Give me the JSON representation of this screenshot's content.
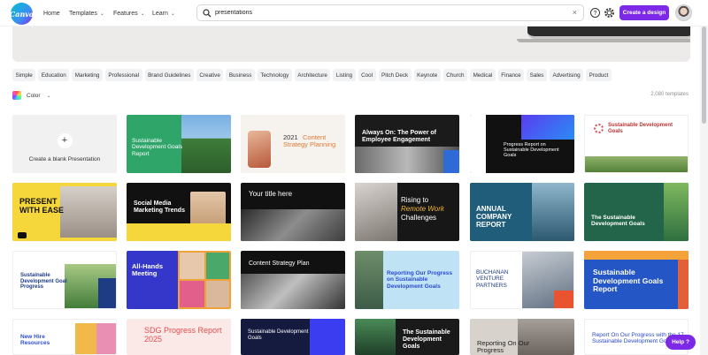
{
  "nav": {
    "home": "Home",
    "templates": "Templates",
    "features": "Features",
    "learn": "Learn"
  },
  "logo_text": "Canva",
  "search": {
    "value": "presentations",
    "placeholder": "Search"
  },
  "create_button": "Create a design",
  "chips": [
    "Simple",
    "Education",
    "Marketing",
    "Professional",
    "Brand Guidelines",
    "Creative",
    "Business",
    "Technology",
    "Architecture",
    "Listing",
    "Cool",
    "Pitch Deck",
    "Keynote",
    "Church",
    "Medical",
    "Finance",
    "Sales",
    "Advertising",
    "Product"
  ],
  "color_filter": "Color",
  "template_count": "2,080 templates",
  "blank_label": "Create a blank Presentation",
  "tiles": {
    "r1c2": "Sustainable Development Goals Report",
    "r1c3_year": "2021",
    "r1c3_title": "Content Strategy Planning",
    "r1c4": "Always On: The Power of Employee Engagement",
    "r1c5": "Progress Report on Sustainable Development Goals",
    "r1c6": "Sustainable Development Goals",
    "r2c1": "PRESENT WITH EASE",
    "r2c2": "Social Media Marketing Trends",
    "r2c3": "Your title here",
    "r2c4_a": "Rising to",
    "r2c4_b": "Remote Work",
    "r2c4_c": "Challenges",
    "r2c5": "ANNUAL COMPANY REPORT",
    "r2c6": "The Sustainable Development Goals",
    "r3c1": "Sustainable Development Goal Progress",
    "r3c2": "All-Hands Meeting",
    "r3c3": "Content Strategy Plan",
    "r3c4": "Reporting Our Progress on Sustainable Development Goals",
    "r3c5": "BUCHANAN VENTURE PARTNERS",
    "r3c6": "Sustainable Development Goals Report",
    "r4c1": "New Hire Resources",
    "r4c2": "SDG Progress Report 2025",
    "r4c3": "Sustainable Development Goals",
    "r4c4": "The Sustainable Development Goals",
    "r4c5": "Reporting On Our Progress",
    "r4c6": "Report On Our Progress with the 17 Sustainable Development Goals"
  },
  "help_button": "Help ?",
  "colors": {
    "accent": "#7d2ae8"
  }
}
